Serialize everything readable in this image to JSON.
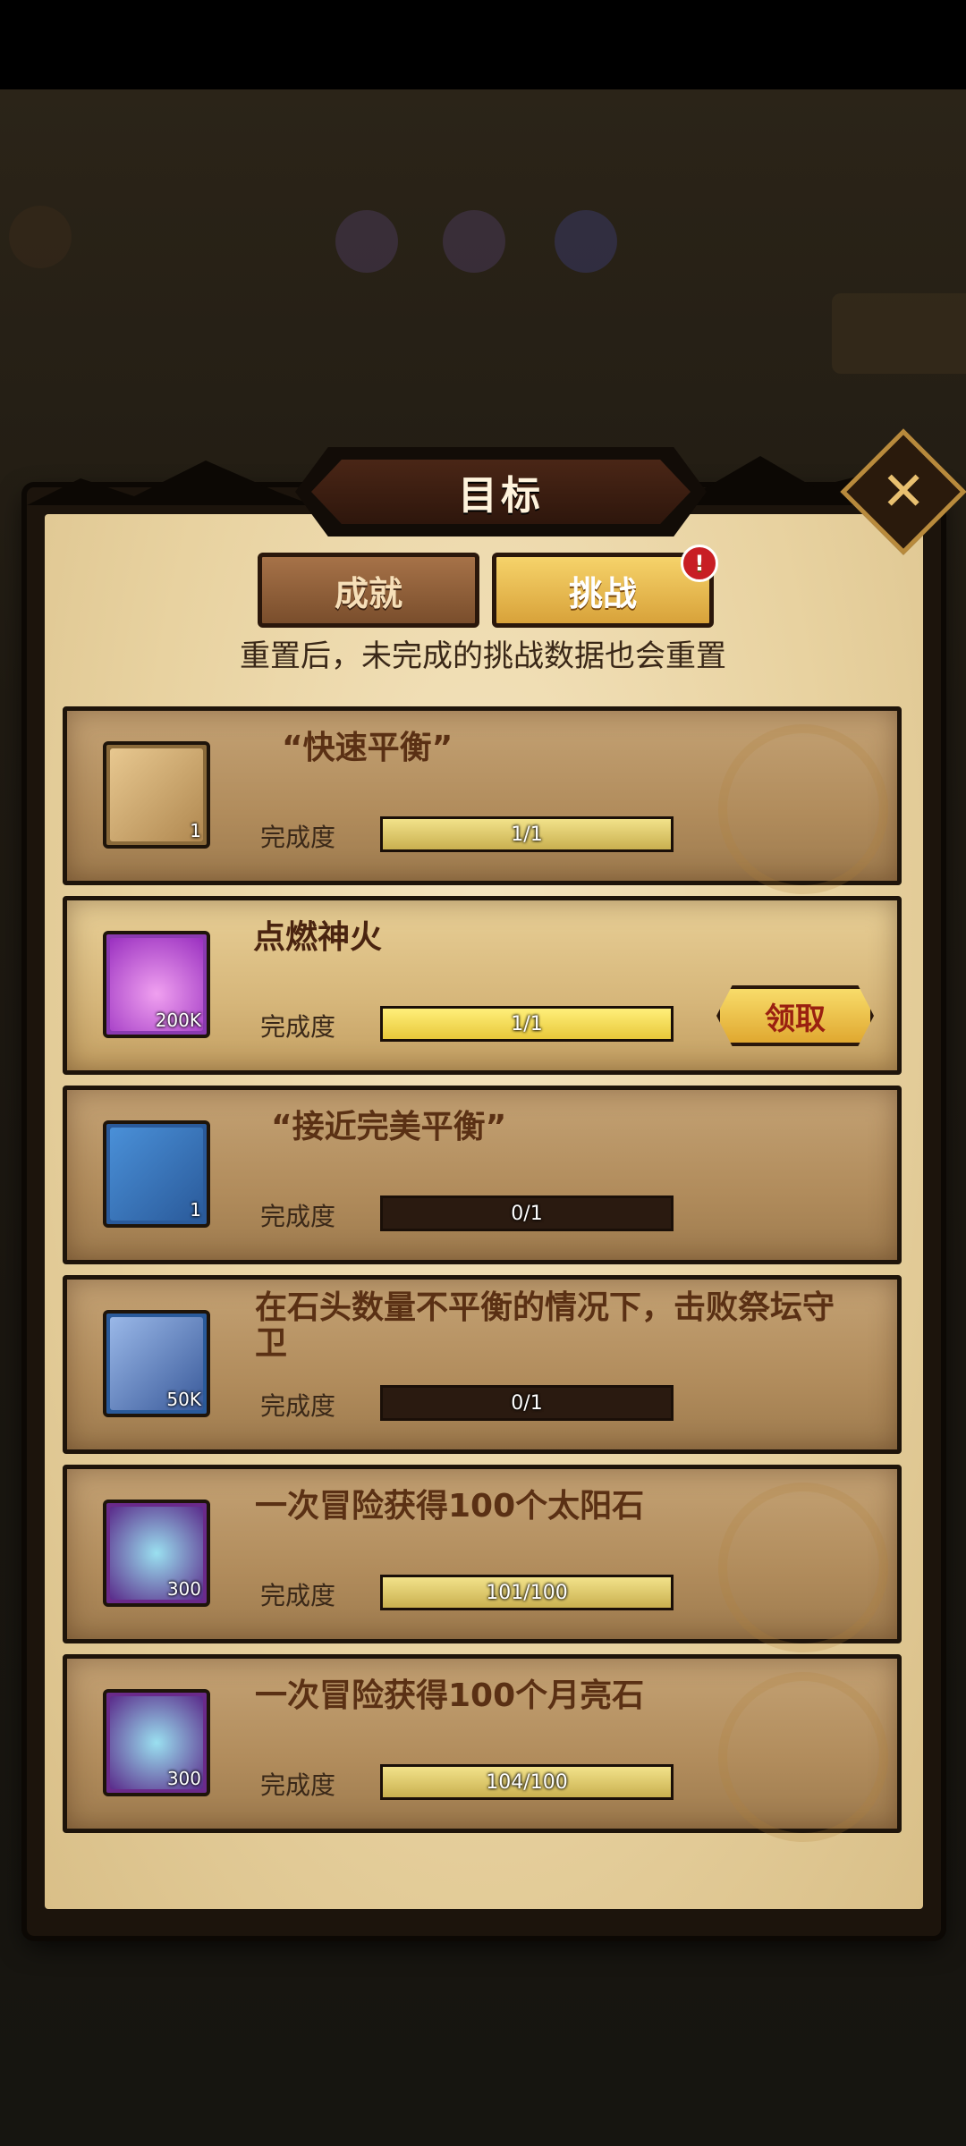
{
  "dialog": {
    "title": "目标",
    "tabs": [
      {
        "label": "成就",
        "active": false
      },
      {
        "label": "挑战",
        "active": true,
        "badge": "!"
      }
    ],
    "notice": "重置后，未完成的挑战数据也会重置",
    "progress_label": "完成度",
    "claim_label": "领取"
  },
  "challenges": [
    {
      "title": "“快速平衡”",
      "icon": "scroll-icon",
      "qty": "1",
      "progress_text": "1/1",
      "progress": 1.0,
      "state": "completed"
    },
    {
      "title": "点燃神火",
      "icon": "potion-icon",
      "qty": "200K",
      "progress_text": "1/1",
      "progress": 1.0,
      "state": "claimable"
    },
    {
      "title": "“接近完美平衡”",
      "icon": "frame-icon",
      "qty": "1",
      "progress_text": "0/1",
      "progress": 0.0,
      "state": "incomplete"
    },
    {
      "title": "在石头数量不平衡的情况下，击败祭坛守卫",
      "icon": "book-icon",
      "qty": "50K",
      "progress_text": "0/1",
      "progress": 0.0,
      "state": "incomplete"
    },
    {
      "title": "一次冒险获得100个太阳石",
      "icon": "diamond-icon",
      "qty": "300",
      "progress_text": "101/100",
      "progress": 1.0,
      "state": "completed"
    },
    {
      "title": "一次冒险获得100个月亮石",
      "icon": "diamond-icon",
      "qty": "300",
      "progress_text": "104/100",
      "progress": 1.0,
      "state": "completed"
    }
  ],
  "colors": {
    "tab_active": "#f6d36a",
    "tab_inactive": "#a67248",
    "badge": "#c81e24",
    "claim_text": "#9a2010"
  }
}
